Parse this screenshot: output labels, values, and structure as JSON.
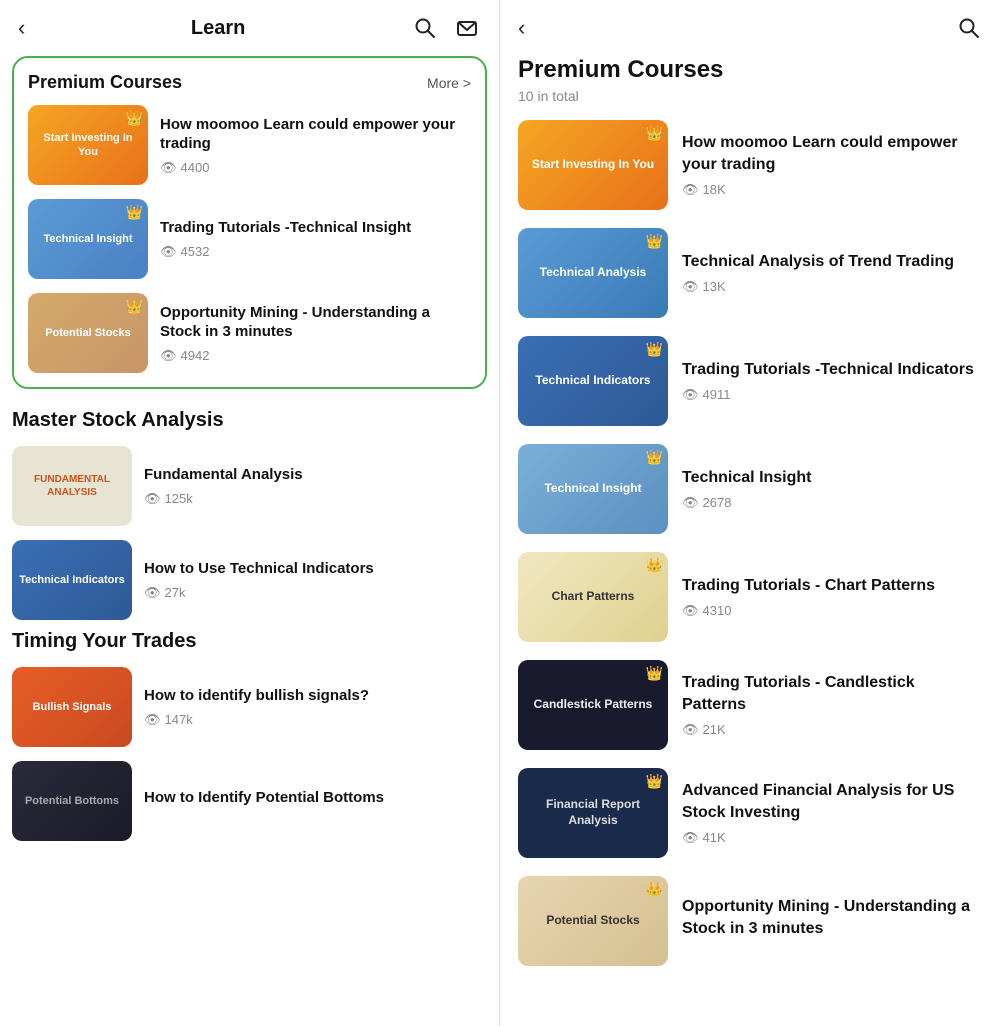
{
  "left": {
    "header": {
      "title": "Learn",
      "back_label": "‹",
      "search_label": "🔍",
      "mail_label": "✉"
    },
    "premium_courses": {
      "title": "Premium Courses",
      "more": "More >",
      "items": [
        {
          "thumb_class": "thumb-orange",
          "thumb_text": "Start Investing In You",
          "title": "How moomoo Learn could empower your trading",
          "views": "4400"
        },
        {
          "thumb_class": "thumb-blue",
          "thumb_text": "Technical Insight",
          "title": "Trading Tutorials -Technical Insight",
          "views": "4532"
        },
        {
          "thumb_class": "thumb-tan",
          "thumb_text": "Potential Stocks",
          "title": "Opportunity Mining - Understanding a Stock in 3 minutes",
          "views": "4942"
        }
      ]
    },
    "master_section": {
      "title": "Master Stock Analysis",
      "items": [
        {
          "thumb_class": "thumb-gray",
          "thumb_text": "FUNDAMENTAL ANALYSIS",
          "title": "Fundamental Analysis",
          "views": "125k"
        },
        {
          "thumb_class": "thumb-darkblue",
          "thumb_text": "Technical Indicators",
          "title": "How to Use Technical Indicators",
          "views": "27k"
        }
      ]
    },
    "timing_section": {
      "title": "Timing Your Trades",
      "items": [
        {
          "thumb_class": "thumb-red-orange",
          "thumb_text": "Bullish Signals",
          "title": "How to identify bullish signals?",
          "views": "147k"
        },
        {
          "thumb_class": "thumb-dark",
          "thumb_text": "Potential Bottoms",
          "title": "How to Identify Potential Bottoms",
          "views": ""
        }
      ]
    }
  },
  "right": {
    "header": {
      "back_label": "‹",
      "search_label": "🔍"
    },
    "title": "Premium Courses",
    "subtitle": "10 in total",
    "items": [
      {
        "thumb_class": "thumb-orange",
        "thumb_text": "Start Investing In You",
        "title": "How moomoo Learn could empower your trading",
        "views": "18K"
      },
      {
        "thumb_class": "thumb-blue",
        "thumb_text": "Technical Analysis",
        "title": "Technical Analysis of Trend Trading",
        "views": "13K"
      },
      {
        "thumb_class": "thumb-darkblue",
        "thumb_text": "Technical Indicators",
        "title": "Trading Tutorials -Technical Indicators",
        "views": "4911"
      },
      {
        "thumb_class": "thumb-blue",
        "thumb_text": "Technical Insight",
        "title": "Technical Insight",
        "views": "2678"
      },
      {
        "thumb_class": "thumb-chartpatterns",
        "thumb_text": "Chart Patterns",
        "title": "Trading Tutorials - Chart Patterns",
        "views": "4310"
      },
      {
        "thumb_class": "thumb-candlestick",
        "thumb_text": "Candlestick Patterns",
        "title": "Trading Tutorials - Candlestick Patterns",
        "views": "21K"
      },
      {
        "thumb_class": "thumb-financial",
        "thumb_text": "Financial Report Analysis",
        "title": "Advanced Financial Analysis for US Stock Investing",
        "views": "41K"
      },
      {
        "thumb_class": "thumb-potential",
        "thumb_text": "Potential Stocks",
        "title": "Opportunity Mining - Understanding a Stock in 3 minutes",
        "views": "..."
      }
    ]
  }
}
